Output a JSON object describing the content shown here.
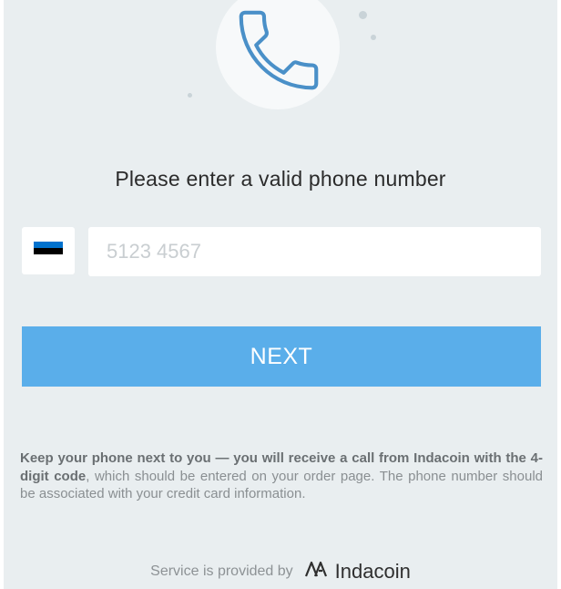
{
  "header": {
    "icon": "phone-icon",
    "title": "Please enter a valid phone number"
  },
  "phone": {
    "country_flag": "estonia-flag-icon",
    "flag_colors": [
      "#0072ce",
      "#000000",
      "#ffffff"
    ],
    "placeholder": "5123 4567",
    "value": ""
  },
  "next_button": {
    "label": "NEXT",
    "color": "#5aaeea"
  },
  "info": {
    "bold_text": "Keep your phone next to you — you will receive a call from Indacoin with the 4-digit code",
    "regular_text": ", which should be entered on your order page. The phone number should be associated with your credit card information."
  },
  "footer": {
    "provided_by": "Service is provided by",
    "brand_name": "Indacoin",
    "brand_icon": "indacoin-logo-icon"
  }
}
